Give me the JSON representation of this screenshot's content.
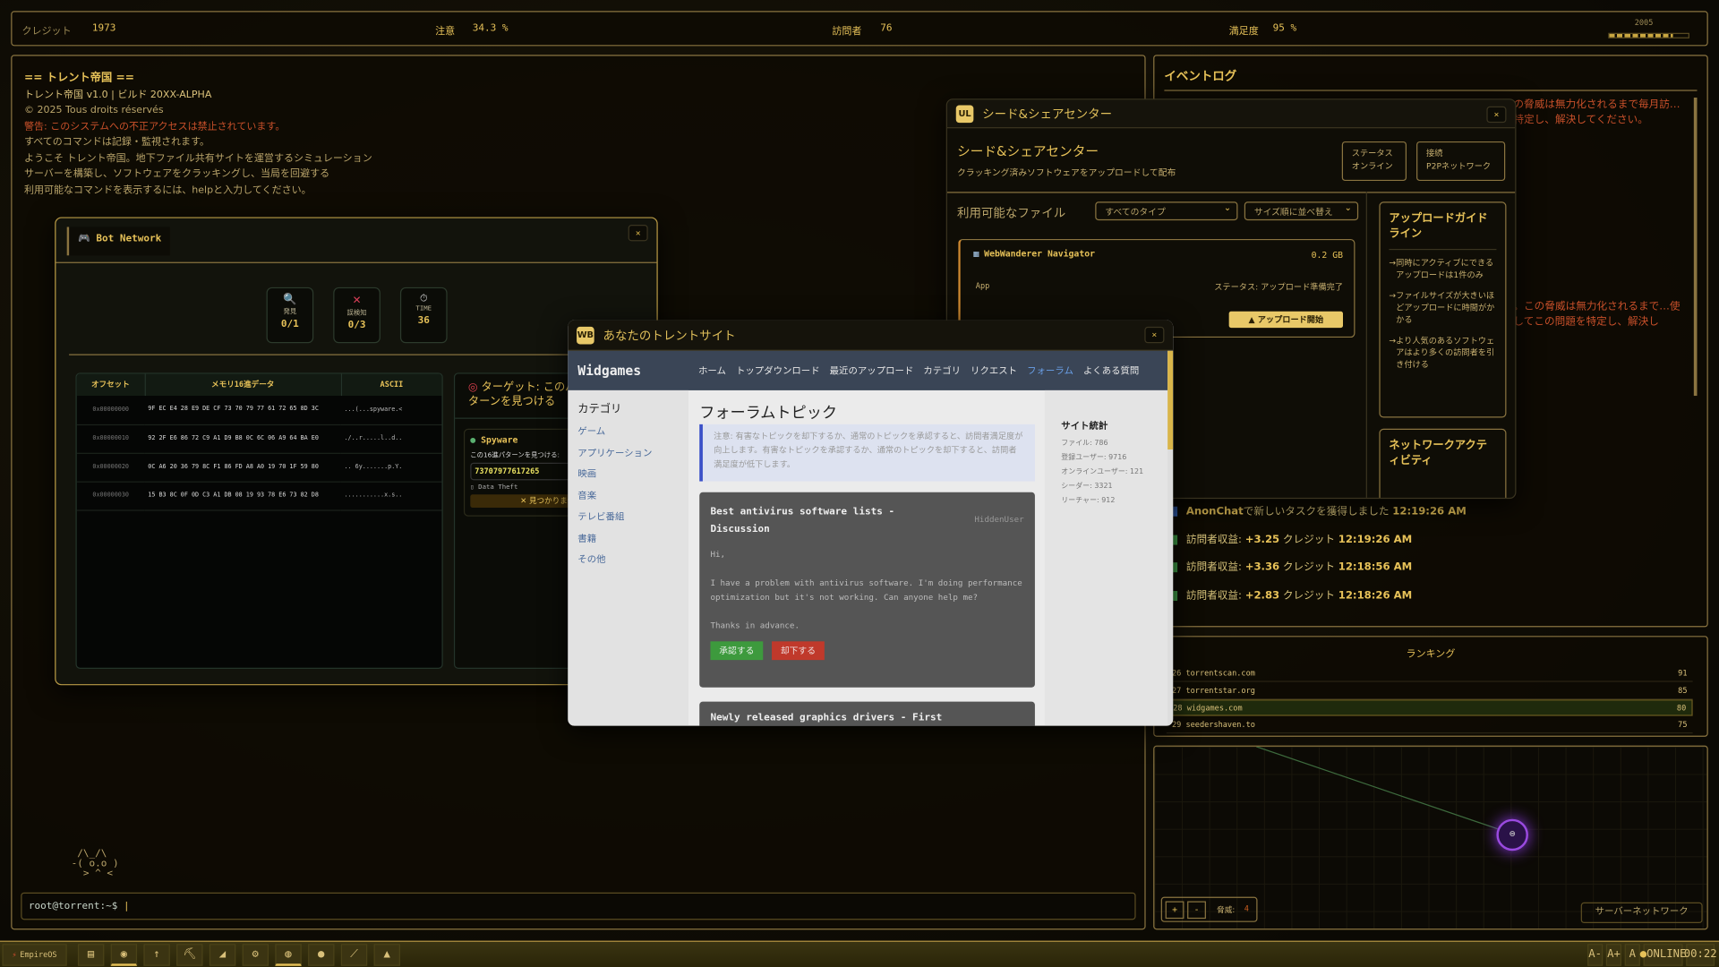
{
  "topbar": {
    "credits_label": "クレジット",
    "credits": "1973",
    "attention_label": "注意",
    "attention": "34.3 %",
    "visitors_label": "訪問者",
    "visitors": "76",
    "satisfaction_label": "満足度",
    "satisfaction": "95 %",
    "year": "2005",
    "year_progress": 0.8
  },
  "terminal": {
    "lines": [
      "== トレント帝国 ==",
      "トレント帝国 v1.0 | ビルド 20XX-ALPHA",
      "© 2025 Tous droits réservés",
      "警告: このシステムへの不正アクセスは禁止されています。",
      "すべてのコマンドは記録・監視されます。",
      "ようこそ トレント帝国。地下ファイル共有サイトを運営するシミュレーション",
      "サーバーを構築し、ソフトウェアをクラッキングし、当局を回避する",
      "利用可能なコマンドを表示するには、helpと入力してください。"
    ],
    "ascii_cat": " /\\_/\\\n-( o.o )\n  > ^ <",
    "prompt": "root@torrent:~$"
  },
  "bot_window": {
    "title": "Bot Network",
    "stats": [
      {
        "label": "発見",
        "value": "0/1"
      },
      {
        "label": "誤検知",
        "value": "0/3"
      },
      {
        "label": "TIME",
        "value": "36"
      }
    ],
    "hex": {
      "headers": [
        "オフセット",
        "メモリ16進データ",
        "ASCII"
      ],
      "rows": [
        [
          "0x00000000",
          "9F EC E4 28 E9 DE CF 73 70 79 77 61 72 65 8D 3C",
          "...(...spyware.<"
        ],
        [
          "0x00000010",
          "92 2F E6 86 72 C9 A1 D9 B8 0C 6C 06 A9 64 BA E0",
          "./..r.....l..d.."
        ],
        [
          "0x00000020",
          "0C A6 20 36 79 8C F1 86 FD A8 A0 19 70 1F 59 80",
          ".. 6y.......p.Y."
        ],
        [
          "0x00000030",
          "15 B3 8C 0F 0D C3 A1 DB 08 19 93 78 E6 73 82 D8",
          "...........x.s.."
        ]
      ]
    },
    "target": {
      "title": "ターゲット: このパターンを見つける",
      "name": "Spyware",
      "instruction": "この16進パターンを見つける:",
      "pattern": "73707977617265",
      "category": "Data Theft",
      "status": "✕ 見つかりません"
    }
  },
  "seed_window": {
    "icon": "UL",
    "title": "シード&シェアセンター",
    "heading": "シード&シェアセンター",
    "subtitle": "クラッキング済みソフトウェアをアップロードして配布",
    "status_label": "ステータス",
    "status": "オンライン",
    "conn_label": "接続",
    "conn": "P2Pネットワーク",
    "files_label": "利用可能なファイル",
    "type_filter": "すべてのタイプ",
    "sort": "サイズ順に並べ替え",
    "file": {
      "name": "WebWanderer Navigator",
      "size": "0.2 GB",
      "type": "App",
      "status": "ステータス: アップロード準備完了",
      "button": "▲ アップロード開始"
    },
    "guide_title": "アップロードガイドライン",
    "guide": [
      "同時にアクティブにできるアップロードは1件のみ",
      "ファイルサイズが大きいほどアップロードに時間がかかる",
      "より人気のあるソフトウェアはより多くの訪問者を引き付ける"
    ],
    "network_title": "ネットワークアクティビティ"
  },
  "event_log": {
    "title": "イベントログ",
    "alert1": "…の脅威は無力化されるまで毎月訪…を特定し、解決してください。",
    "alert2": "…。この脅威は無力化されるまで…使用してこの問題を特定し、解決し",
    "entries": [
      {
        "pre": "",
        "bold": "AnonChat",
        "text": "で新しいタスクを獲得しました",
        "time": "12:19:26 AM",
        "color": "#3b6fd0"
      },
      {
        "pre": "訪問者収益: ",
        "bold": "+3.25",
        "text": " クレジット",
        "time": "12:19:26 AM",
        "color": "#3d9a45"
      },
      {
        "pre": "訪問者収益: ",
        "bold": "+3.36",
        "text": " クレジット",
        "time": "12:18:56 AM",
        "color": "#3d9a45"
      },
      {
        "pre": "訪問者収益: ",
        "bold": "+2.83",
        "text": " クレジット",
        "time": "12:18:26 AM",
        "color": "#3d9a45"
      }
    ]
  },
  "ranking": {
    "title": "ランキング",
    "rows": [
      {
        "rank": "26",
        "site": "torrentscan.com",
        "score": "91"
      },
      {
        "rank": "27",
        "site": "torrentstar.org",
        "score": "85"
      },
      {
        "rank": "28",
        "site": "widgames.com",
        "score": "80",
        "highlight": true
      },
      {
        "rank": "29",
        "site": "seedershaven.to",
        "score": "75"
      }
    ]
  },
  "network_map": {
    "zoom_in": "+",
    "zoom_out": "-",
    "threat_label": "脅威:",
    "threat": "4",
    "button": "サーバーネットワーク"
  },
  "site_window": {
    "icon": "WB",
    "title": "あなたのトレントサイト",
    "brand": "Widgames",
    "nav": [
      "ホーム",
      "トップダウンロード",
      "最近のアップロード",
      "カテゴリ",
      "リクエスト",
      "フォーラム",
      "よくある質問"
    ],
    "active_nav": 5,
    "categories_title": "カテゴリ",
    "categories": [
      "ゲーム",
      "アプリケーション",
      "映画",
      "音楽",
      "テレビ番組",
      "書籍",
      "その他"
    ],
    "forum_title": "フォーラムトピック",
    "notice": "注意: 有害なトピックを却下するか、通常のトピックを承認すると、訪問者満足度が向上します。有害なトピックを承認するか、通常のトピックを却下すると、訪問者満足度が低下します。",
    "posts": [
      {
        "title": "Best antivirus software lists - Discussion",
        "author": "HiddenUser",
        "body": [
          "Hi,",
          "I have a problem with antivirus software. I'm doing performance optimization but it's not working. Can anyone help me?",
          "Thanks in advance."
        ],
        "approve": "承認する",
        "reject": "却下する"
      },
      {
        "title": "Newly released graphics drivers - First"
      }
    ],
    "stats_title": "サイト統計",
    "stats": [
      "ファイル: 786",
      "登録ユーザー: 9716",
      "オンラインユーザー: 121",
      "シーダー: 3321",
      "リーチャー: 912"
    ]
  },
  "taskbar": {
    "start": "EmpireOS",
    "apps": [
      "terminal",
      "bot",
      "upload",
      "crack",
      "alert",
      "settings",
      "web",
      "chat",
      "tools",
      "lock"
    ],
    "font_buttons": [
      "A-",
      "A+",
      "A"
    ],
    "online": "ONLINE",
    "clock": "00:22"
  }
}
